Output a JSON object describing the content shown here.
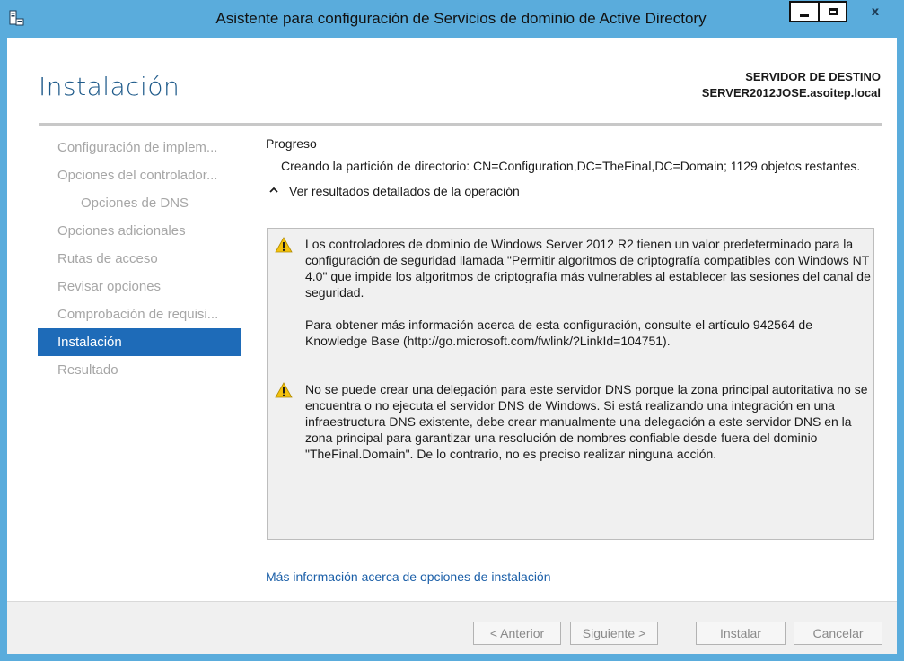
{
  "window": {
    "title": "Asistente para configuración de Servicios de dominio de Active Directory",
    "close_glyph": "x"
  },
  "header": {
    "page_title": "Instalación",
    "destination_label": "SERVIDOR DE DESTINO",
    "destination_server": "SERVER2012JOSE.asoitep.local"
  },
  "nav": {
    "items": [
      {
        "label": "Configuración de implem...",
        "state": "inactive"
      },
      {
        "label": "Opciones del controlador...",
        "state": "inactive"
      },
      {
        "label": "Opciones de DNS",
        "state": "inactive"
      },
      {
        "label": "Opciones adicionales",
        "state": "inactive"
      },
      {
        "label": "Rutas de acceso",
        "state": "inactive"
      },
      {
        "label": "Revisar opciones",
        "state": "inactive"
      },
      {
        "label": "Comprobación de requisi...",
        "state": "inactive"
      },
      {
        "label": "Instalación",
        "state": "active"
      },
      {
        "label": "Resultado",
        "state": "inactive"
      }
    ]
  },
  "content": {
    "progress_heading": "Progreso",
    "progress_text": "Creando la partición de directorio: CN=Configuration,DC=TheFinal,DC=Domain; 1129 objetos restantes.",
    "details_toggle": "Ver resultados detallados de la operación",
    "messages": [
      {
        "icon": "warning-icon",
        "paragraphs": [
          "Los controladores de dominio de Windows Server 2012 R2 tienen un valor predeterminado para la configuración de seguridad llamada \"Permitir algoritmos de criptografía compatibles con Windows NT 4.0\" que impide los algoritmos de criptografía más vulnerables al establecer las sesiones del canal de seguridad.",
          "Para obtener más información acerca de esta configuración, consulte el artículo 942564 de Knowledge Base (http://go.microsoft.com/fwlink/?LinkId=104751)."
        ]
      },
      {
        "icon": "warning-icon",
        "paragraphs": [
          "No se puede crear una delegación para este servidor DNS porque la zona principal autoritativa no se encuentra o no ejecuta el servidor DNS de Windows. Si está realizando una integración en una infraestructura DNS existente, debe crear manualmente una delegación a este servidor DNS en la zona principal para garantizar una resolución de nombres confiable desde fuera del dominio \"TheFinal.Domain\". De lo contrario, no es preciso realizar ninguna acción."
        ]
      }
    ],
    "more_info_link": "Más información acerca de opciones de instalación"
  },
  "footer": {
    "back_label": "< Anterior",
    "next_label": "Siguiente >",
    "install_label": "Instalar",
    "cancel_label": "Cancelar"
  },
  "colors": {
    "titlebar": "#5aacdc",
    "accent": "#1e6bb8",
    "link": "#1b5fa8",
    "warning": "#f4c20d"
  }
}
